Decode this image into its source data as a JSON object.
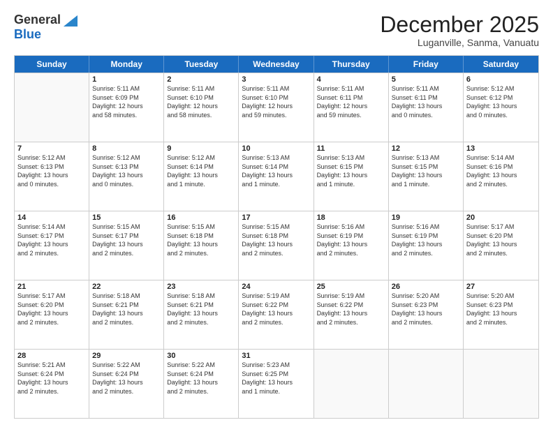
{
  "logo": {
    "general": "General",
    "blue": "Blue"
  },
  "title": "December 2025",
  "subtitle": "Luganville, Sanma, Vanuatu",
  "header_days": [
    "Sunday",
    "Monday",
    "Tuesday",
    "Wednesday",
    "Thursday",
    "Friday",
    "Saturday"
  ],
  "weeks": [
    [
      {
        "day": "",
        "info": ""
      },
      {
        "day": "1",
        "info": "Sunrise: 5:11 AM\nSunset: 6:09 PM\nDaylight: 12 hours\nand 58 minutes."
      },
      {
        "day": "2",
        "info": "Sunrise: 5:11 AM\nSunset: 6:10 PM\nDaylight: 12 hours\nand 58 minutes."
      },
      {
        "day": "3",
        "info": "Sunrise: 5:11 AM\nSunset: 6:10 PM\nDaylight: 12 hours\nand 59 minutes."
      },
      {
        "day": "4",
        "info": "Sunrise: 5:11 AM\nSunset: 6:11 PM\nDaylight: 12 hours\nand 59 minutes."
      },
      {
        "day": "5",
        "info": "Sunrise: 5:11 AM\nSunset: 6:11 PM\nDaylight: 13 hours\nand 0 minutes."
      },
      {
        "day": "6",
        "info": "Sunrise: 5:12 AM\nSunset: 6:12 PM\nDaylight: 13 hours\nand 0 minutes."
      }
    ],
    [
      {
        "day": "7",
        "info": "Sunrise: 5:12 AM\nSunset: 6:13 PM\nDaylight: 13 hours\nand 0 minutes."
      },
      {
        "day": "8",
        "info": "Sunrise: 5:12 AM\nSunset: 6:13 PM\nDaylight: 13 hours\nand 0 minutes."
      },
      {
        "day": "9",
        "info": "Sunrise: 5:12 AM\nSunset: 6:14 PM\nDaylight: 13 hours\nand 1 minute."
      },
      {
        "day": "10",
        "info": "Sunrise: 5:13 AM\nSunset: 6:14 PM\nDaylight: 13 hours\nand 1 minute."
      },
      {
        "day": "11",
        "info": "Sunrise: 5:13 AM\nSunset: 6:15 PM\nDaylight: 13 hours\nand 1 minute."
      },
      {
        "day": "12",
        "info": "Sunrise: 5:13 AM\nSunset: 6:15 PM\nDaylight: 13 hours\nand 1 minute."
      },
      {
        "day": "13",
        "info": "Sunrise: 5:14 AM\nSunset: 6:16 PM\nDaylight: 13 hours\nand 2 minutes."
      }
    ],
    [
      {
        "day": "14",
        "info": "Sunrise: 5:14 AM\nSunset: 6:17 PM\nDaylight: 13 hours\nand 2 minutes."
      },
      {
        "day": "15",
        "info": "Sunrise: 5:15 AM\nSunset: 6:17 PM\nDaylight: 13 hours\nand 2 minutes."
      },
      {
        "day": "16",
        "info": "Sunrise: 5:15 AM\nSunset: 6:18 PM\nDaylight: 13 hours\nand 2 minutes."
      },
      {
        "day": "17",
        "info": "Sunrise: 5:15 AM\nSunset: 6:18 PM\nDaylight: 13 hours\nand 2 minutes."
      },
      {
        "day": "18",
        "info": "Sunrise: 5:16 AM\nSunset: 6:19 PM\nDaylight: 13 hours\nand 2 minutes."
      },
      {
        "day": "19",
        "info": "Sunrise: 5:16 AM\nSunset: 6:19 PM\nDaylight: 13 hours\nand 2 minutes."
      },
      {
        "day": "20",
        "info": "Sunrise: 5:17 AM\nSunset: 6:20 PM\nDaylight: 13 hours\nand 2 minutes."
      }
    ],
    [
      {
        "day": "21",
        "info": "Sunrise: 5:17 AM\nSunset: 6:20 PM\nDaylight: 13 hours\nand 2 minutes."
      },
      {
        "day": "22",
        "info": "Sunrise: 5:18 AM\nSunset: 6:21 PM\nDaylight: 13 hours\nand 2 minutes."
      },
      {
        "day": "23",
        "info": "Sunrise: 5:18 AM\nSunset: 6:21 PM\nDaylight: 13 hours\nand 2 minutes."
      },
      {
        "day": "24",
        "info": "Sunrise: 5:19 AM\nSunset: 6:22 PM\nDaylight: 13 hours\nand 2 minutes."
      },
      {
        "day": "25",
        "info": "Sunrise: 5:19 AM\nSunset: 6:22 PM\nDaylight: 13 hours\nand 2 minutes."
      },
      {
        "day": "26",
        "info": "Sunrise: 5:20 AM\nSunset: 6:23 PM\nDaylight: 13 hours\nand 2 minutes."
      },
      {
        "day": "27",
        "info": "Sunrise: 5:20 AM\nSunset: 6:23 PM\nDaylight: 13 hours\nand 2 minutes."
      }
    ],
    [
      {
        "day": "28",
        "info": "Sunrise: 5:21 AM\nSunset: 6:24 PM\nDaylight: 13 hours\nand 2 minutes."
      },
      {
        "day": "29",
        "info": "Sunrise: 5:22 AM\nSunset: 6:24 PM\nDaylight: 13 hours\nand 2 minutes."
      },
      {
        "day": "30",
        "info": "Sunrise: 5:22 AM\nSunset: 6:24 PM\nDaylight: 13 hours\nand 2 minutes."
      },
      {
        "day": "31",
        "info": "Sunrise: 5:23 AM\nSunset: 6:25 PM\nDaylight: 13 hours\nand 1 minute."
      },
      {
        "day": "",
        "info": ""
      },
      {
        "day": "",
        "info": ""
      },
      {
        "day": "",
        "info": ""
      }
    ]
  ]
}
